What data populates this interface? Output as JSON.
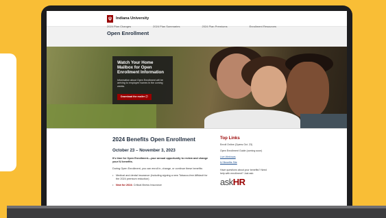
{
  "site": {
    "university": "Indiana University",
    "page_title": "Open Enrollment",
    "subnav": [
      "2024 Plan Changes",
      "2024 Plan Summaries",
      "2024 Plan Premiums",
      "Enrollment Resources"
    ]
  },
  "hero": {
    "heading": "Watch Your Home Mailbox for Open Enrollment Information",
    "body": "Information about Open Enrollment will be arriving to employee homes in the coming weeks.",
    "button": "Download the mailer ⓘ"
  },
  "main": {
    "heading": "2024 Benefits Open Enrollment",
    "dates": "October 23 – November 3, 2023",
    "lead": "It's time for Open Enrollment—your annual opportunity to review and change your IU benefits.",
    "para": "During Open Enrollment, you can enroll in, change, or continue these benefits:",
    "bullets": [
      {
        "text": "Medical and dental insurance (including signing a new Tobacco-free Affidavit for the 2024 premium reduction)",
        "prefix": ""
      },
      {
        "text": "Critical Illness Insurance",
        "prefix": "New for 2024:"
      }
    ]
  },
  "aside": {
    "title": "Top Links",
    "links": [
      "Enroll Online (Opens Oct. 23)",
      "Open Enrollment Guide (coming soon)",
      "Live Webinars",
      "IU Benefits Site"
    ],
    "question": "Have questions about your benefits? Need help with enrollment? Just ask:",
    "askhr_light": "ask",
    "askhr_bold": "HR"
  }
}
